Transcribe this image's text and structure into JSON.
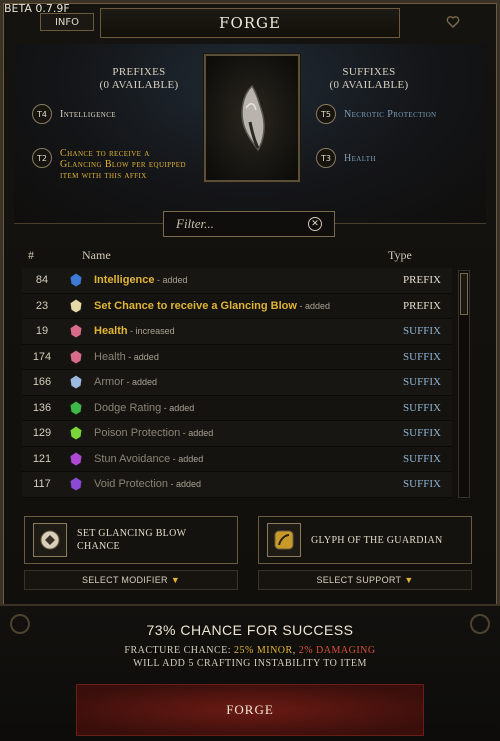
{
  "version": "BETA 0.7.9F",
  "info_label": "INFO",
  "title": "FORGE",
  "prefixes": {
    "heading": "PREFIXES",
    "available": "(0 AVAILABLE)",
    "items": [
      {
        "tier": "T4",
        "text": "Intelligence",
        "color": "white"
      },
      {
        "tier": "T2",
        "text": "Chance to receive a Glancing Blow per equipped item with this affix",
        "color": "gold"
      }
    ]
  },
  "suffixes": {
    "heading": "SUFFIXES",
    "available": "(0 AVAILABLE)",
    "items": [
      {
        "tier": "T5",
        "text": "Necrotic Protection",
        "color": "blue"
      },
      {
        "tier": "T3",
        "text": "Health",
        "color": "blue"
      }
    ]
  },
  "filter": {
    "placeholder": "Filter...",
    "value": ""
  },
  "columns": {
    "num": "#",
    "name": "Name",
    "type": "Type"
  },
  "rows": [
    {
      "num": "84",
      "name": "Intelligence",
      "note": " - added",
      "type": "PREFIX",
      "name_color": "#e0b434",
      "bold": true,
      "type_color": "#e6dfcc",
      "gem": "#3d7ad6"
    },
    {
      "num": "23",
      "name": "Set Chance to receive a Glancing Blow",
      "note": " - added",
      "type": "PREFIX",
      "name_color": "#e0b434",
      "bold": true,
      "type_color": "#e6dfcc",
      "gem": "#e6d8a8"
    },
    {
      "num": "19",
      "name": "Health",
      "note": " - increased",
      "type": "SUFFIX",
      "name_color": "#e0b434",
      "bold": true,
      "type_color": "#8fb4d2",
      "gem": "#d86a8a"
    },
    {
      "num": "174",
      "name": "Health",
      "note": " - added",
      "type": "SUFFIX",
      "name_color": "#8a8476",
      "bold": false,
      "type_color": "#8fb4d2",
      "gem": "#d86a8a"
    },
    {
      "num": "166",
      "name": "Armor",
      "note": " - added",
      "type": "SUFFIX",
      "name_color": "#8a8476",
      "bold": false,
      "type_color": "#8fb4d2",
      "gem": "#9ab8e0"
    },
    {
      "num": "136",
      "name": "Dodge Rating",
      "note": " - added",
      "type": "SUFFIX",
      "name_color": "#8a8476",
      "bold": false,
      "type_color": "#8fb4d2",
      "gem": "#3fb84a"
    },
    {
      "num": "129",
      "name": "Poison Protection",
      "note": " - added",
      "type": "SUFFIX",
      "name_color": "#8a8476",
      "bold": false,
      "type_color": "#8fb4d2",
      "gem": "#7ad63a"
    },
    {
      "num": "121",
      "name": "Stun Avoidance",
      "note": " - added",
      "type": "SUFFIX",
      "name_color": "#8a8476",
      "bold": false,
      "type_color": "#8fb4d2",
      "gem": "#b04ad6"
    },
    {
      "num": "117",
      "name": "Void Protection",
      "note": " - added",
      "type": "SUFFIX",
      "name_color": "#8a8476",
      "bold": false,
      "type_color": "#8fb4d2",
      "gem": "#8a4ad6"
    }
  ],
  "modifier_slot": {
    "label_line1": "SET GLANCING BLOW",
    "label_line2": "CHANCE",
    "select_label": "SELECT MODIFIER"
  },
  "support_slot": {
    "label": "GLYPH OF THE GUARDIAN",
    "select_label": "SELECT SUPPORT"
  },
  "success_text": "73% CHANCE FOR SUCCESS",
  "fracture": {
    "prefix": "FRACTURE CHANCE: ",
    "minor_pct": "25%",
    "minor": " MINOR",
    "sep": ", ",
    "damaging_pct": "2%",
    "damaging": " DAMAGING"
  },
  "instability_text": "WILL ADD 5 CRAFTING INSTABILITY TO ITEM",
  "forge_button": "FORGE"
}
